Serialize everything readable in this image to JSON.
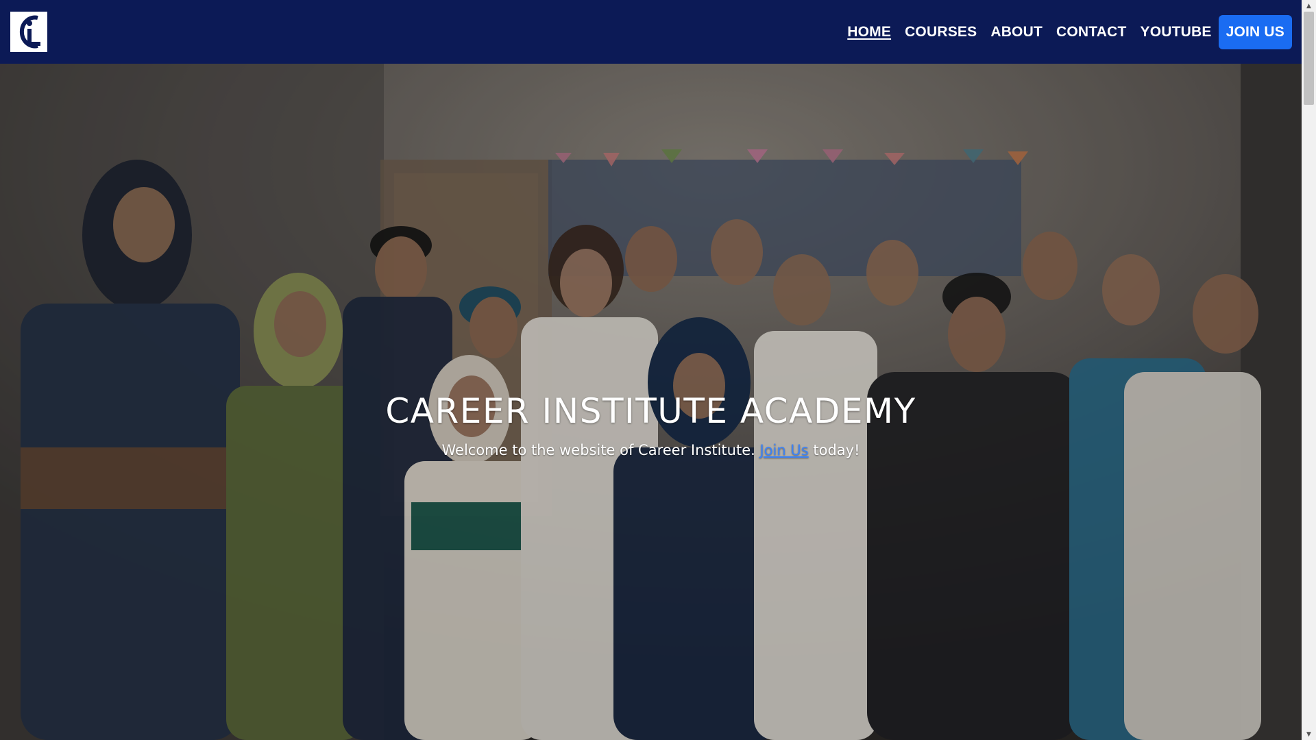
{
  "nav": {
    "links": [
      {
        "label": "HOME",
        "active": true
      },
      {
        "label": "COURSES",
        "active": false
      },
      {
        "label": "ABOUT",
        "active": false
      },
      {
        "label": "CONTACT",
        "active": false
      },
      {
        "label": "YOUTUBE",
        "active": false
      }
    ],
    "cta_label": "JOIN US"
  },
  "hero": {
    "title": "CAREER INSTITUTE ACADEMY",
    "subtitle_before": "Welcome to the website of Career Institute.",
    "subtitle_link": "Join Us",
    "subtitle_after": "today!"
  },
  "colors": {
    "navbar_bg": "#0c1a56",
    "cta_bg": "#1a6cf2",
    "link": "#3b82f6"
  },
  "icons": {
    "logo": "career-institute-logo-icon",
    "scroll_up": "scroll-up-arrow-icon",
    "scroll_down": "scroll-down-arrow-icon"
  }
}
